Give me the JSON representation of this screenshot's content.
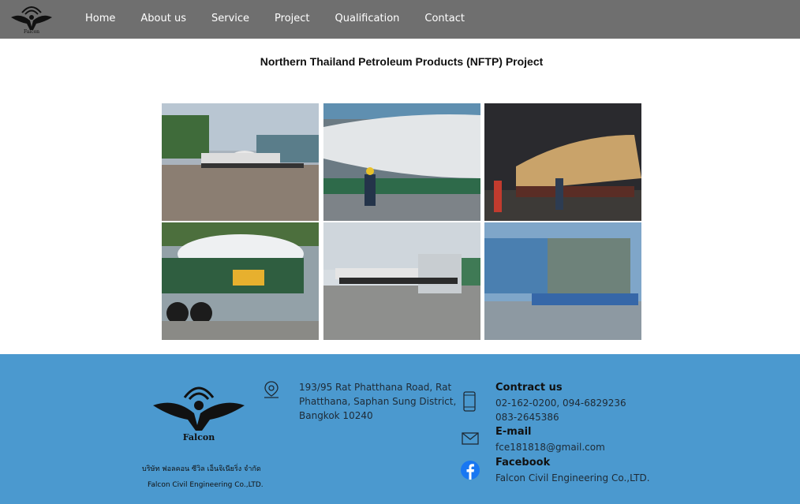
{
  "nav": {
    "items": [
      "Home",
      "About us",
      "Service",
      "Project",
      "Qualification",
      "Contact"
    ],
    "logo_icon": "falcon-logo-icon"
  },
  "page": {
    "title": "Northern Thailand Petroleum Products (NFTP) Project"
  },
  "gallery": {
    "photos": [
      "tank-convoy-photo",
      "tank-on-trailer-photo",
      "night-tank-transport-photo",
      "windsor-tank-trailer-photo",
      "truck-convoy-road-photo",
      "covered-module-photo"
    ]
  },
  "footer": {
    "company_thai": "บริษัท ฟอลคอน ซีวิล เอ็นจิเนียริ่ง จำกัด",
    "company_en": "Falcon Civil Engineering Co.,LTD.",
    "address": [
      "193/95 Rat Phatthana Road, Rat",
      "Phatthana, Saphan Sung District,",
      "Bangkok 10240"
    ],
    "contact_heading": "Contract us",
    "phones": [
      "02-162-0200, 094-6829236",
      "083-2645386"
    ],
    "email_heading": "E-mail",
    "email": "fce181818@gmail.com",
    "facebook_heading": "Facebook",
    "facebook": "Falcon Civil Engineering Co.,LTD.",
    "logo_text": "Falcon"
  },
  "colors": {
    "nav_bg": "#6f6f6f",
    "footer_bg": "#4b99cf",
    "facebook_blue": "#1877f2"
  }
}
